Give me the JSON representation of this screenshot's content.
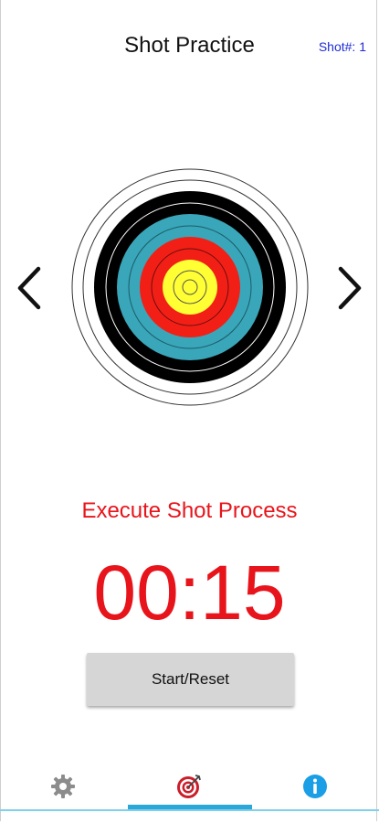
{
  "header": {
    "title": "Shot Practice",
    "shot_count": "Shot#: 1"
  },
  "target": {
    "icon": "archery-target-icon",
    "ring_colors": {
      "white": "#ffffff",
      "black": "#000000",
      "blue": "#3aa6b9",
      "red": "#f21f17",
      "gold": "#ffff33"
    }
  },
  "navigation": {
    "previous_icon": "chevron-left-icon",
    "next_icon": "chevron-right-icon"
  },
  "instruction": {
    "text": "Execute Shot Process"
  },
  "timer": {
    "value": "00:15"
  },
  "actions": {
    "start_reset_label": "Start/Reset"
  },
  "bottom_nav": {
    "items": [
      {
        "icon": "gear-icon",
        "selected": false
      },
      {
        "icon": "target-icon",
        "selected": true
      },
      {
        "icon": "info-icon",
        "selected": false
      }
    ],
    "accent_color": "#2ca7da"
  },
  "colors": {
    "accent_red": "#e8141b",
    "shot_count_blue": "#1e2bd8"
  }
}
